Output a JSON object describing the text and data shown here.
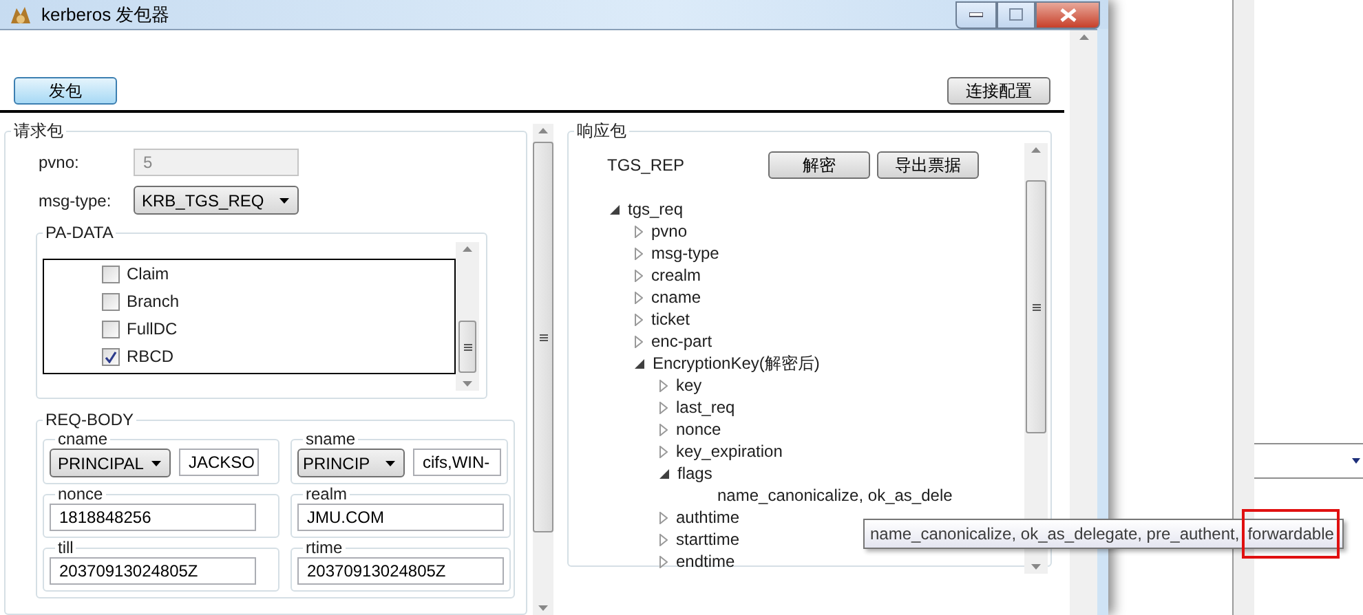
{
  "window": {
    "title": "kerberos 发包器"
  },
  "toolbar": {
    "send_button": "发包",
    "config_button": "连接配置"
  },
  "request": {
    "title": "请求包",
    "pvno": {
      "label": "pvno:",
      "value": "5",
      "disabled": true
    },
    "msg_type": {
      "label": "msg-type:",
      "value": "KRB_TGS_REQ"
    },
    "pa_data": {
      "title": "PA-DATA",
      "options": [
        {
          "label": "Claim",
          "checked": false
        },
        {
          "label": "Branch",
          "checked": false
        },
        {
          "label": "FullDC",
          "checked": false
        },
        {
          "label": "RBCD",
          "checked": true
        }
      ]
    },
    "req_body": {
      "title": "REQ-BODY",
      "fields": [
        {
          "kind": "combo",
          "label": "cname",
          "type": "PRINCIPAL",
          "value": "JACKSO"
        },
        {
          "kind": "combo",
          "label": "sname",
          "type": "PRINCIP",
          "value": "cifs,WIN-"
        },
        {
          "kind": "text",
          "label": "nonce",
          "value": "1818848256"
        },
        {
          "kind": "text",
          "label": "realm",
          "value": "JMU.COM"
        },
        {
          "kind": "text",
          "label": "till",
          "value": "20370913024805Z"
        },
        {
          "kind": "text",
          "label": "rtime",
          "value": "20370913024805Z"
        }
      ]
    }
  },
  "response": {
    "title": "响应包",
    "type_label": "TGS_REP",
    "buttons": [
      "解密",
      "导出票据"
    ],
    "tree": [
      {
        "kind": "node",
        "label": "tgs_req",
        "expanded": true,
        "children": [
          {
            "kind": "node",
            "label": "pvno",
            "expanded": false
          },
          {
            "kind": "node",
            "label": "msg-type",
            "expanded": false
          },
          {
            "kind": "node",
            "label": "crealm",
            "expanded": false
          },
          {
            "kind": "node",
            "label": "cname",
            "expanded": false
          },
          {
            "kind": "node",
            "label": "ticket",
            "expanded": false
          },
          {
            "kind": "node",
            "label": "enc-part",
            "expanded": false
          },
          {
            "kind": "node",
            "label": "EncryptionKey(解密后)",
            "expanded": true,
            "children": [
              {
                "kind": "node",
                "label": "key",
                "expanded": false
              },
              {
                "kind": "node",
                "label": "last_req",
                "expanded": false
              },
              {
                "kind": "node",
                "label": "nonce",
                "expanded": false
              },
              {
                "kind": "node",
                "label": "key_expiration",
                "expanded": false
              },
              {
                "kind": "node",
                "label": "flags",
                "expanded": true,
                "children": [
                  {
                    "kind": "value",
                    "label": "name_canonicalize, ok_as_dele"
                  }
                ]
              },
              {
                "kind": "node",
                "label": "authtime",
                "expanded": false
              },
              {
                "kind": "node",
                "label": "starttime",
                "expanded": false
              },
              {
                "kind": "node",
                "label": "endtime",
                "expanded": false
              }
            ]
          }
        ]
      }
    ]
  },
  "tooltip": {
    "text": "name_canonicalize, ok_as_delegate, pre_authent,",
    "highlighted": "forwardable"
  }
}
